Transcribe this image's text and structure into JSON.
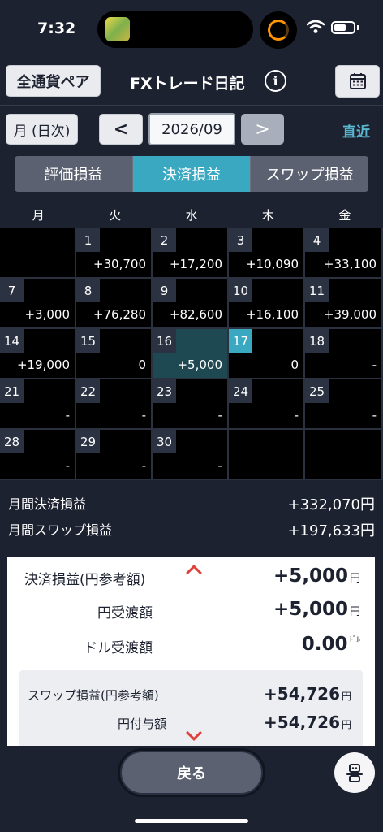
{
  "status": {
    "time": "7:32"
  },
  "header": {
    "pair_label": "全通貨ペア",
    "title": "FXトレード日記",
    "info_icon": "i"
  },
  "nav": {
    "mode_label": "月 (日次)",
    "prev_symbol": "<",
    "month_value": "2026/09",
    "next_symbol": ">",
    "recent_label": "直近"
  },
  "tabs": [
    {
      "label": "評価損益",
      "active": false
    },
    {
      "label": "決済損益",
      "active": true
    },
    {
      "label": "スワップ損益",
      "active": false
    }
  ],
  "weekdays": [
    "月",
    "火",
    "水",
    "木",
    "金"
  ],
  "calendar": {
    "weeks": [
      [
        {
          "day": "",
          "pl": ""
        },
        {
          "day": "1",
          "pl": "+30,700"
        },
        {
          "day": "2",
          "pl": "+17,200"
        },
        {
          "day": "3",
          "pl": "+10,090"
        },
        {
          "day": "4",
          "pl": "+33,100"
        }
      ],
      [
        {
          "day": "7",
          "pl": "+3,000"
        },
        {
          "day": "8",
          "pl": "+76,280"
        },
        {
          "day": "9",
          "pl": "+82,600"
        },
        {
          "day": "10",
          "pl": "+16,100"
        },
        {
          "day": "11",
          "pl": "+39,000"
        }
      ],
      [
        {
          "day": "14",
          "pl": "+19,000"
        },
        {
          "day": "15",
          "pl": "0"
        },
        {
          "day": "16",
          "pl": "+5,000",
          "today": true
        },
        {
          "day": "17",
          "pl": "0",
          "selected": true
        },
        {
          "day": "18",
          "pl": "-"
        }
      ],
      [
        {
          "day": "21",
          "pl": "-"
        },
        {
          "day": "22",
          "pl": "-"
        },
        {
          "day": "23",
          "pl": "-"
        },
        {
          "day": "24",
          "pl": "-"
        },
        {
          "day": "25",
          "pl": "-"
        }
      ],
      [
        {
          "day": "28",
          "pl": "-"
        },
        {
          "day": "29",
          "pl": "-"
        },
        {
          "day": "30",
          "pl": "-"
        },
        {
          "day": "",
          "pl": ""
        },
        {
          "day": "",
          "pl": ""
        }
      ]
    ]
  },
  "totals": {
    "settled_label": "月間決済損益",
    "settled_value": "+332,070円",
    "swap_label": "月間スワップ損益",
    "swap_value": "+197,633円"
  },
  "detail": {
    "settled_label": "決済損益(円参考額)",
    "settled_value": "+5,000",
    "settled_unit": "円",
    "yen_label": "円受渡額",
    "yen_value": "+5,000",
    "yen_unit": "円",
    "usd_label": "ドル受渡額",
    "usd_value": "0.00",
    "usd_unit": "ﾄﾞﾙ",
    "swap_label": "スワップ損益(円参考額)",
    "swap_value": "+54,726",
    "swap_unit": "円",
    "yen_grant_label": "円付与額",
    "yen_grant_value": "+54,726",
    "yen_grant_unit": "円"
  },
  "bottom": {
    "back_label": "戻る"
  },
  "colors": {
    "accent": "#3aa8c0",
    "background": "#1d2230",
    "link": "#59b7d1",
    "chevron": "#e0413a"
  }
}
